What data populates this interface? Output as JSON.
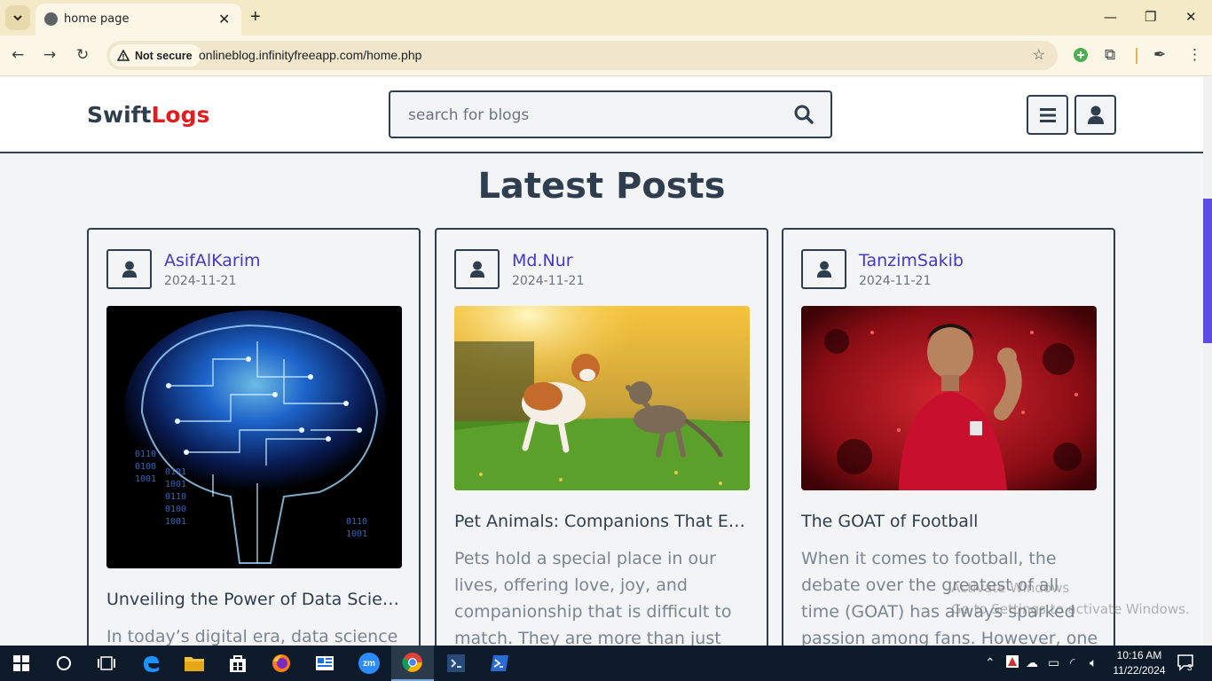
{
  "browser": {
    "tab_title": "home page",
    "tab_close": "✕",
    "new_tab": "+",
    "security_label": "Not secure",
    "url": "onlineblog.infinityfreeapp.com/home.php"
  },
  "site": {
    "logo_part1": "Swift",
    "logo_part2": "Logs",
    "logo_colors": {
      "part1": "#2f3e4e",
      "part2": "#e11d1d"
    },
    "search_placeholder": "search for blogs",
    "icons": {
      "search": "search-icon",
      "menu": "menu-icon",
      "user": "user-icon"
    }
  },
  "main": {
    "section_title": "Latest Posts",
    "posts": [
      {
        "author": "AsifAlKarim",
        "date": "2024-11-21",
        "image": "brain-circuit-image",
        "title": "Unveiling the Power of Data Science: Transforming Information into Insight",
        "excerpt": "In today’s digital era, data science"
      },
      {
        "author": "Md.Nur",
        "date": "2024-11-21",
        "image": "dog-and-cat-image",
        "title": "Pet Animals: Companions That Enrich Our Lives",
        "excerpt": "Pets hold a special place in our lives, offering love, joy, and companionship that is difficult to match. They are more than just"
      },
      {
        "author": "TanzimSakib",
        "date": "2024-11-21",
        "image": "football-player-image",
        "title": "The GOAT of Football",
        "excerpt": "When it comes to football, the debate over the greatest of all time (GOAT) has always sparked passion among fans. However, one name"
      }
    ]
  },
  "watermark": {
    "line1": "Activate Windows",
    "line2": "Go to Settings to activate Windows."
  },
  "taskbar": {
    "time": "10:16 AM",
    "date": "11/22/2024",
    "notification_count": "3",
    "zoom_label": "zm"
  },
  "accent_color": "#4338ca"
}
